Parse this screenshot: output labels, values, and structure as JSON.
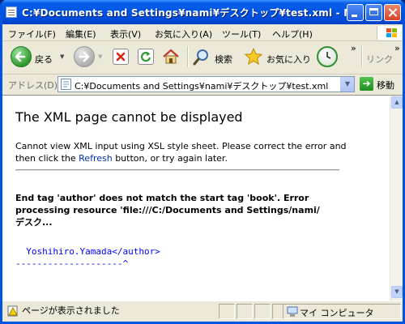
{
  "window": {
    "title": "C:¥Documents and Settings¥nami¥デスクトップ¥test.xml - Mi..."
  },
  "menu": {
    "items": [
      "ファイル(F)",
      "編集(E)",
      "表示(V)",
      "お気に入り(A)",
      "ツール(T)",
      "ヘルプ(H)"
    ]
  },
  "toolbar": {
    "back_label": "戻る",
    "search_label": "検索",
    "favorites_label": "お気に入り",
    "links_label": "リンク"
  },
  "address": {
    "label": "アドレス(D)",
    "value": "C:¥Documents and Settings¥nami¥デスクトップ¥test.xml",
    "go_label": "移動"
  },
  "page": {
    "title": "The XML page cannot be displayed",
    "desc_before": "Cannot view XML input using XSL style sheet. Please correct the error and then click the ",
    "desc_link": "Refresh",
    "desc_after": " button, or try again later.",
    "error_detail": "End tag 'author' does not match the start tag 'book'. Error processing resource 'file:///C:/Documents and Settings/nami/デスク...",
    "source_line": "  Yoshihiro.Yamada</author>",
    "pointer_line": "--------------------^"
  },
  "status": {
    "message": "ページが表示されました",
    "zone": "マイ コンピュータ"
  },
  "colors": {
    "titlebar": "#0055e5",
    "link": "#0033a8",
    "source_text": "#0000ff"
  }
}
